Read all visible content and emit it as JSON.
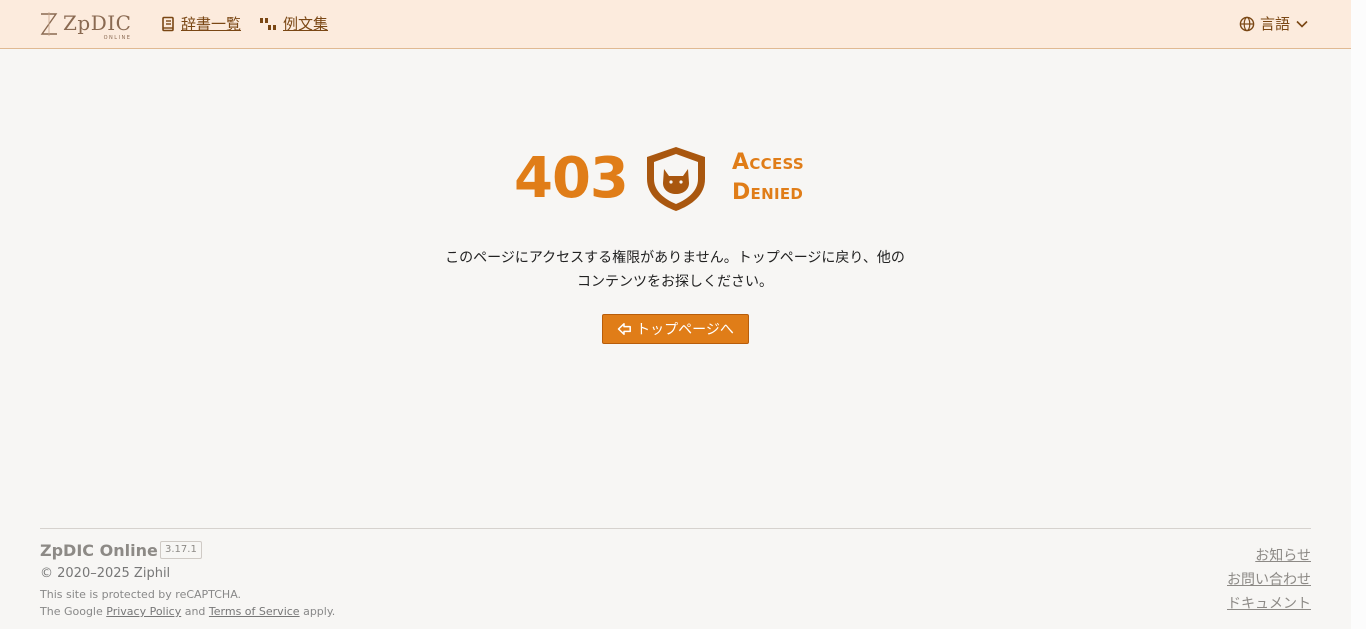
{
  "header": {
    "logo_text": "ZpDIC",
    "logo_sub": "ONLINE",
    "nav": [
      {
        "label": "辞書一覧",
        "icon": "book-icon"
      },
      {
        "label": "例文集",
        "icon": "quote-icon"
      }
    ],
    "language_label": "言語"
  },
  "error": {
    "code": "403",
    "title_line1": "Access",
    "title_line2": "Denied",
    "message_line1": "このページにアクセスする権限がありません。トップページに戻り、他の",
    "message_line2": "コンテンツをお探しください。",
    "button_label": "トップページへ"
  },
  "footer": {
    "name": "ZpDIC Online",
    "version": "3.17.1",
    "copyright": "© 2020–2025  Ziphil",
    "recaptcha_line1": "This site is protected by reCAPTCHA.",
    "recaptcha_prefix": "The Google ",
    "privacy_label": "Privacy Policy",
    "and_text": " and ",
    "terms_label": "Terms of Service",
    "apply_text": " apply.",
    "links": [
      "お知らせ",
      "お問い合わせ",
      "ドキュメント"
    ]
  },
  "colors": {
    "accent": "#e07d18",
    "header_bg": "#fcebdd",
    "link": "#7a4714",
    "shield": "#a9570f"
  }
}
